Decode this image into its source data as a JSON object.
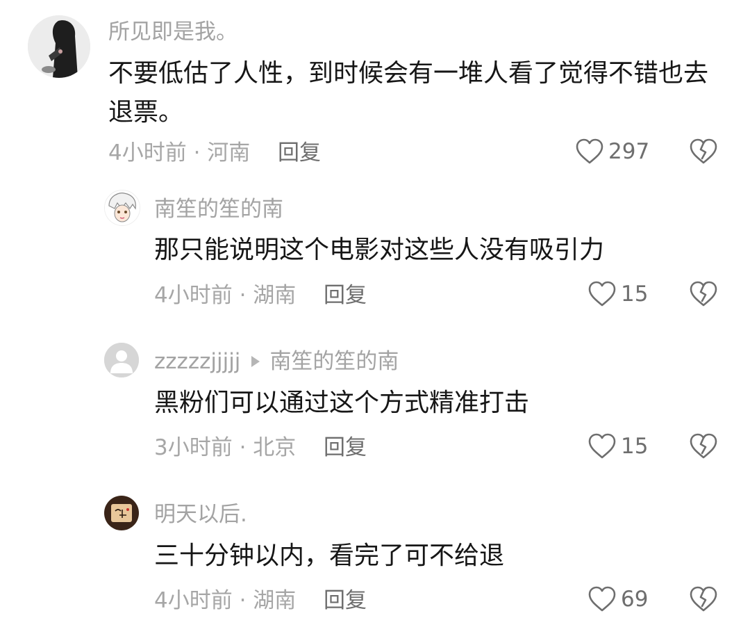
{
  "comment": {
    "username": "所见即是我。",
    "text": "不要低估了人性，到时候会有一堆人看了觉得不错也去退票。",
    "time": "4小时前",
    "location": "河南",
    "reply_label": "回复",
    "likes": "297"
  },
  "replies": [
    {
      "username": "南笙的笙的南",
      "text": "那只能说明这个电影对这些人没有吸引力",
      "time": "4小时前",
      "location": "湖南",
      "reply_label": "回复",
      "likes": "15"
    },
    {
      "username": "zzzzzjjjjj",
      "reply_to": "南笙的笙的南",
      "text": "黑粉们可以通过这个方式精准打击",
      "time": "3小时前",
      "location": "北京",
      "reply_label": "回复",
      "likes": "15"
    },
    {
      "username": "明天以后.",
      "text": "三十分钟以内，看完了可不给退",
      "time": "4小时前",
      "location": "湖南",
      "reply_label": "回复",
      "likes": "69"
    }
  ],
  "icons": {
    "like": "heart-outline-icon",
    "dislike": "broken-heart-icon"
  },
  "colors": {
    "name": "#a3a3a3",
    "text": "#161616",
    "meta": "#a6a6a6",
    "action": "#6e6e6e"
  }
}
